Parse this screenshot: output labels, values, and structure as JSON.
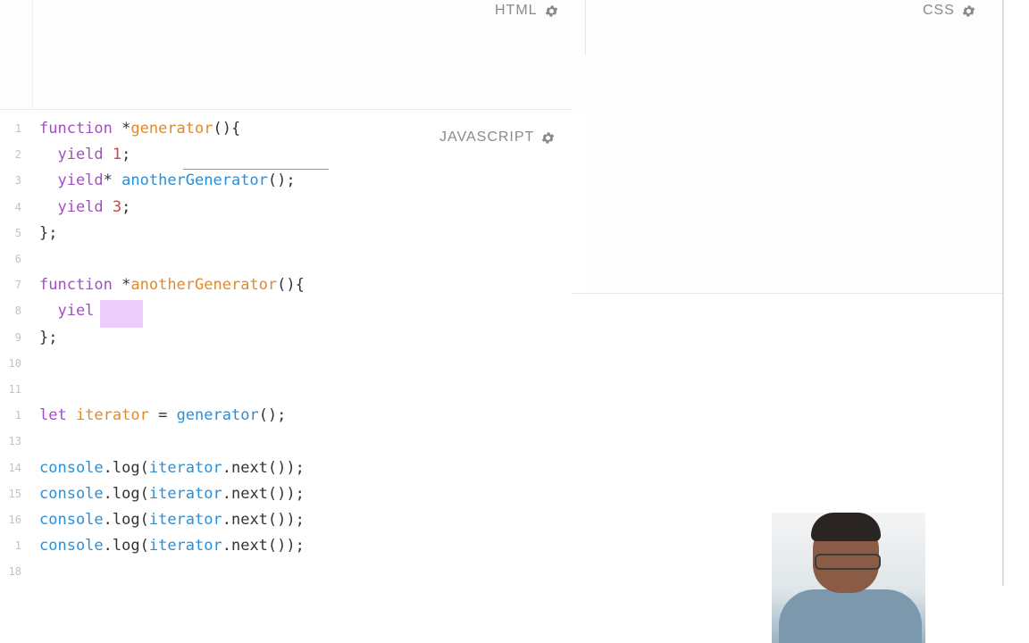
{
  "panes": {
    "html_label": "HTML",
    "css_label": "CSS",
    "js_label": "JAVASCRIPT"
  },
  "editor": {
    "lines": [
      {
        "num": "1",
        "tokens": [
          {
            "t": "function ",
            "c": "kw"
          },
          {
            "t": "*",
            "c": "pl"
          },
          {
            "t": "generator",
            "c": "fn"
          },
          {
            "t": "(){",
            "c": "pl"
          }
        ]
      },
      {
        "num": "2",
        "tokens": [
          {
            "t": "  yield ",
            "c": "kw"
          },
          {
            "t": "1",
            "c": "num"
          },
          {
            "t": ";",
            "c": "pl"
          }
        ]
      },
      {
        "num": "3",
        "tokens": [
          {
            "t": "  yield",
            "c": "kw"
          },
          {
            "t": "* ",
            "c": "pl"
          },
          {
            "t": "anotherGenerator",
            "c": "id"
          },
          {
            "t": "();",
            "c": "pl"
          }
        ]
      },
      {
        "num": "4",
        "tokens": [
          {
            "t": "  yield ",
            "c": "kw"
          },
          {
            "t": "3",
            "c": "num"
          },
          {
            "t": ";",
            "c": "pl"
          }
        ]
      },
      {
        "num": "5",
        "tokens": [
          {
            "t": "};",
            "c": "pl"
          }
        ]
      },
      {
        "num": "6",
        "tokens": []
      },
      {
        "num": "7",
        "tokens": [
          {
            "t": "function ",
            "c": "kw"
          },
          {
            "t": "*",
            "c": "pl"
          },
          {
            "t": "anotherGenerator",
            "c": "fn"
          },
          {
            "t": "(){",
            "c": "pl"
          }
        ]
      },
      {
        "num": "8",
        "tokens": [
          {
            "t": "  yiel",
            "c": "kw"
          }
        ]
      },
      {
        "num": "9",
        "tokens": [
          {
            "t": "};",
            "c": "pl"
          }
        ]
      },
      {
        "num": "10",
        "tokens": []
      },
      {
        "num": "11",
        "tokens": []
      },
      {
        "num": "1",
        "tokens": [
          {
            "t": "let ",
            "c": "kw"
          },
          {
            "t": "iterator",
            "c": "fn"
          },
          {
            "t": " = ",
            "c": "pl"
          },
          {
            "t": "generator",
            "c": "id"
          },
          {
            "t": "();",
            "c": "pl"
          }
        ]
      },
      {
        "num": "13",
        "tokens": []
      },
      {
        "num": "14",
        "tokens": [
          {
            "t": "console",
            "c": "id"
          },
          {
            "t": ".log(",
            "c": "pl"
          },
          {
            "t": "iterator",
            "c": "id"
          },
          {
            "t": ".next());",
            "c": "pl"
          }
        ]
      },
      {
        "num": "15",
        "tokens": [
          {
            "t": "console",
            "c": "id"
          },
          {
            "t": ".log(",
            "c": "pl"
          },
          {
            "t": "iterator",
            "c": "id"
          },
          {
            "t": ".next());",
            "c": "pl"
          }
        ]
      },
      {
        "num": "16",
        "tokens": [
          {
            "t": "console",
            "c": "id"
          },
          {
            "t": ".log(",
            "c": "pl"
          },
          {
            "t": "iterator",
            "c": "id"
          },
          {
            "t": ".next());",
            "c": "pl"
          }
        ]
      },
      {
        "num": "1",
        "tokens": [
          {
            "t": "console",
            "c": "id"
          },
          {
            "t": ".log(",
            "c": "pl"
          },
          {
            "t": "iterator",
            "c": "id"
          },
          {
            "t": ".next());",
            "c": "pl"
          }
        ]
      },
      {
        "num": "18",
        "tokens": []
      }
    ]
  },
  "icons": {
    "html_settings": "gear-icon",
    "css_settings": "gear-icon",
    "js_settings": "gear-icon"
  },
  "colors": {
    "keyword": "#a24ec4",
    "function_name": "#e08a2c",
    "identifier": "#2c8fd6",
    "number": "#d64242",
    "label": "#8a8a8a",
    "selection": "#eccdfb"
  }
}
